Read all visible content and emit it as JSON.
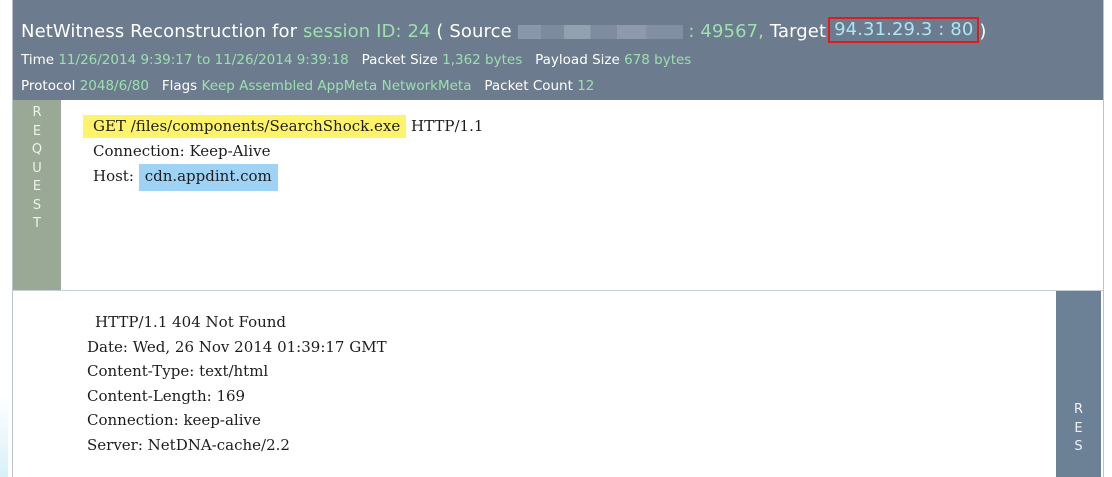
{
  "header": {
    "title": "NetWitness Reconstruction for",
    "session_label": "session ID: 24",
    "source_open": "( Source",
    "source_port": ": 49567,",
    "target_label": "Target",
    "target_value": "94.31.29.3 : 80",
    "close_paren": ")",
    "time_label": "Time",
    "time_value": "11/26/2014 9:39:17 to 11/26/2014 9:39:18",
    "packet_size_label": "Packet Size",
    "packet_size_value": "1,362 bytes",
    "payload_size_label": "Payload Size",
    "payload_size_value": "678 bytes",
    "protocol_label": "Protocol",
    "protocol_value": "2048/6/80",
    "flags_label": "Flags",
    "flags_value": "Keep Assembled AppMeta NetworkMeta",
    "packet_count_label": "Packet Count",
    "packet_count_value": "12",
    "accent_color": "#9be0ad",
    "highlight_box_color": "#e01b1b"
  },
  "request": {
    "tab_letters": [
      "R",
      "E",
      "Q",
      "U",
      "E",
      "S",
      "T"
    ],
    "request_line": "GET /files/components/SearchShock.exe",
    "protocol": "HTTP/1.1",
    "connection": "Connection: Keep-Alive",
    "host_label": "Host:",
    "host_value": "cdn.appdint.com"
  },
  "response": {
    "tab_letters": [
      "R",
      "E",
      "S"
    ],
    "lines": [
      "HTTP/1.1 404 Not Found",
      "Date: Wed, 26 Nov 2014 01:39:17 GMT",
      "Content-Type: text/html",
      "Content-Length: 169",
      "Connection: keep-alive",
      "Server: NetDNA-cache/2.2"
    ]
  }
}
